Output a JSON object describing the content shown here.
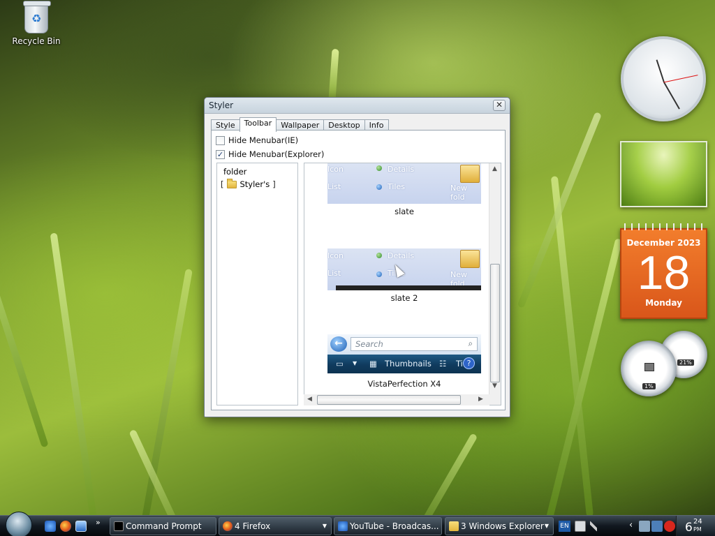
{
  "desktop": {
    "recycle_bin_label": "Recycle Bin"
  },
  "window": {
    "title": "Styler",
    "close_glyph": "✕",
    "tabs": [
      {
        "label": "Style",
        "active": false
      },
      {
        "label": "Toolbar",
        "active": true
      },
      {
        "label": "Wallpaper",
        "active": false
      },
      {
        "label": "Desktop",
        "active": false
      },
      {
        "label": "Info",
        "active": false
      }
    ],
    "checkboxes": [
      {
        "label": "Hide Menubar(IE)",
        "checked": false
      },
      {
        "label": "Hide Menubar(Explorer)",
        "checked": true
      }
    ],
    "tree": {
      "root": "folder",
      "child": "Styler's"
    },
    "themes": [
      {
        "name": "slate",
        "preview_labels": [
          "Icon",
          "List",
          "Details",
          "Tiles",
          "New fold"
        ]
      },
      {
        "name": "slate 2",
        "preview_labels": [
          "Icon",
          "List",
          "Details",
          "Tiles",
          "New fold"
        ]
      },
      {
        "name": "VistaPerfection X4",
        "search_placeholder": "Search",
        "toolbar_label": "Thumbnails",
        "toolbar_trailing": "Ti"
      }
    ],
    "scrollbar_arrows": {
      "up": "▲",
      "down": "▼",
      "left": "◀",
      "right": "▶"
    }
  },
  "gadgets": {
    "calendar": {
      "month": "December 2023",
      "day": "18",
      "weekday": "Monday"
    },
    "meters": {
      "cpu_percent": "1%",
      "memory_percent": "21%"
    }
  },
  "taskbar": {
    "quick_launch_more": "»",
    "tasks": [
      {
        "label": "Command Prompt",
        "icon": "cmd-icon",
        "dropdown": false
      },
      {
        "label": "4 Firefox",
        "icon": "firefox-icon",
        "dropdown": true
      },
      {
        "label": "YouTube - Broadcas...",
        "icon": "ie-icon",
        "dropdown": false
      },
      {
        "label": "3 Windows Explorer",
        "icon": "folder-icon",
        "dropdown": true
      }
    ],
    "tray": {
      "language": "EN",
      "show_hidden": "‹",
      "clock_hour": "6",
      "clock_minute": "24",
      "clock_ampm": "PM"
    }
  },
  "colors": {
    "calendar_orange": "#e8681f",
    "taskbar_dark": "#11181f",
    "window_bg": "#f0f0f0"
  }
}
